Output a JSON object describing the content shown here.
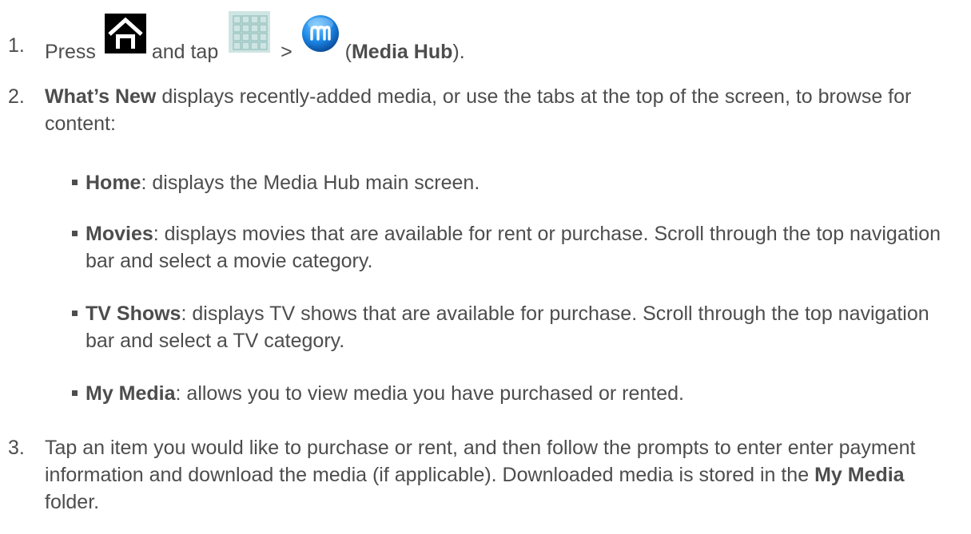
{
  "steps": [
    {
      "num": "1.",
      "press": "Press",
      "and_tap": "and tap",
      "gt": ">",
      "open_paren": "(",
      "app_name": "Media Hub",
      "close_paren": ")."
    },
    {
      "num": "2.",
      "bold": "What’s New",
      "text": " displays recently-added media, or use the tabs at the top of the screen, to browse for content:",
      "bullets": [
        {
          "bold": "Home",
          "text": ": displays the Media Hub main screen."
        },
        {
          "bold": "Movies",
          "text": ": displays movies that are available for rent or purchase. Scroll through the top navigation bar and select a movie category."
        },
        {
          "bold": "TV Shows",
          "text": ": displays TV shows that are available for purchase. Scroll through the top navigation bar and select a TV category."
        },
        {
          "bold": "My Media",
          "text": ": allows you to view media you have purchased or rented."
        }
      ]
    },
    {
      "num": "3.",
      "text1": "Tap an item you would like to purchase or rent, and then follow the prompts to enter enter payment information and download the media (if applicable). Downloaded media is stored in the ",
      "bold": "My Media",
      "text2": " folder."
    }
  ],
  "icons": {
    "home": "home-icon",
    "apps": "apps-grid-icon",
    "media_hub": "media-hub-icon"
  }
}
